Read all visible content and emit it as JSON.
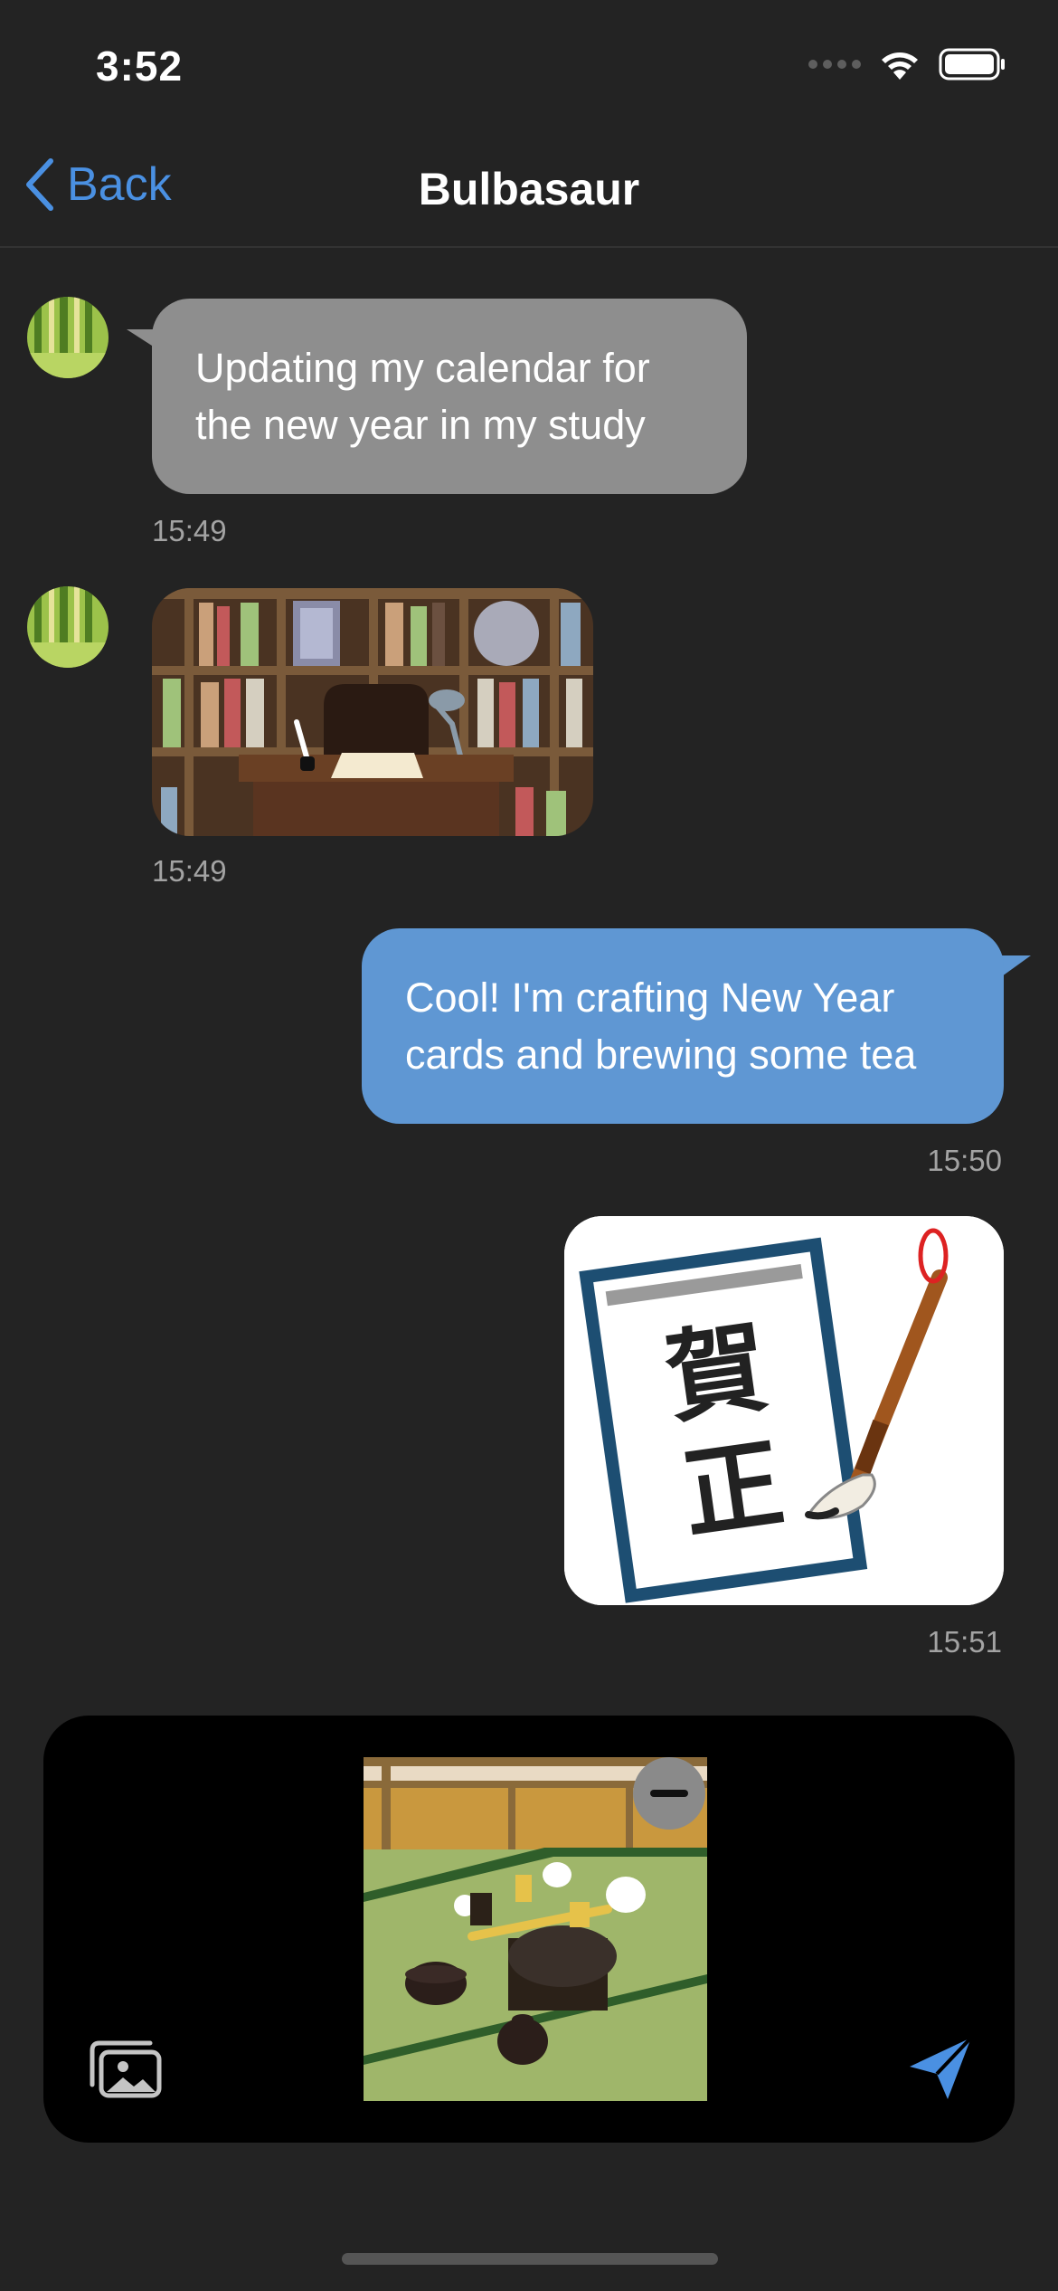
{
  "status_bar": {
    "time": "3:52",
    "battery_icon": "battery-full-icon",
    "wifi_icon": "wifi-icon"
  },
  "nav": {
    "back_label": "Back",
    "title": "Bulbasaur"
  },
  "messages": [
    {
      "direction": "incoming",
      "type": "text",
      "text": "Updating my calendar for the new year in my study",
      "time": "15:49"
    },
    {
      "direction": "incoming",
      "type": "image",
      "image": "study-desk-bookshelf",
      "time": "15:49"
    },
    {
      "direction": "outgoing",
      "type": "text",
      "text": "Cool! I'm crafting New Year cards and brewing some tea",
      "time": "15:50"
    },
    {
      "direction": "outgoing",
      "type": "image",
      "image": "new-year-card-brush",
      "time": "15:51"
    }
  ],
  "composer": {
    "attached_image": "tea-ceremony-room",
    "remove_icon": "minus-circle-icon",
    "gallery_icon": "photo-gallery-icon",
    "send_icon": "paper-plane-icon"
  },
  "colors": {
    "background": "#232323",
    "incoming_bubble": "#8e8e8e",
    "outgoing_bubble": "#5f97d3",
    "accent": "#4a90e2"
  }
}
